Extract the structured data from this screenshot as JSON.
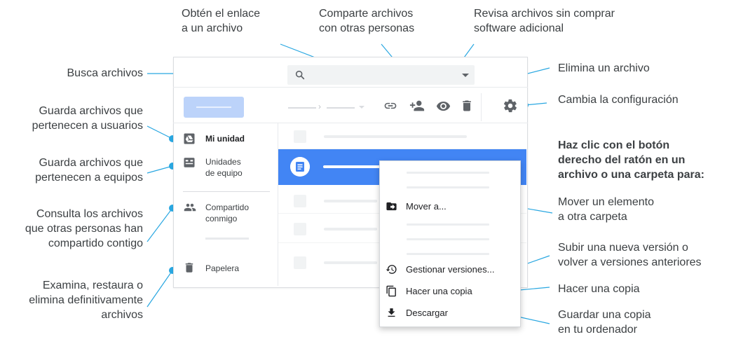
{
  "annotations": {
    "get_link": "Obtén el enlace\na un archivo",
    "share": "Comparte archivos\ncon otras personas",
    "preview": "Revisa archivos sin comprar\nsoftware adicional",
    "search": "Busca archivos",
    "delete": "Elimina un archivo",
    "settings": "Cambia la configuración",
    "my_drive": "Guarda archivos que\npertenecen a usuarios",
    "team_drives": "Guarda archivos que\npertenecen a equipos",
    "shared": "Consulta los archivos\nque otras personas han\ncompartido contigo",
    "trash": "Examina, restaura o\nelimina definitivamente\narchivos",
    "right_click_heading": "Haz clic con el botón\nderecho del ratón en un\narchivo o una carpeta para:",
    "move": "Mover un elemento\na otra carpeta",
    "versions": "Subir una nueva versión o\nvolver a versiones anteriores",
    "copy": "Hacer una copia",
    "download": "Guardar una copia\nen tu ordenador"
  },
  "sidebar": {
    "my_drive": "Mi unidad",
    "team_drives": "Unidades\nde equipo",
    "shared_with_me": "Compartido\nconmigo",
    "trash": "Papelera"
  },
  "context_menu": {
    "move": "Mover a...",
    "manage_versions": "Gestionar versiones...",
    "make_copy": "Hacer una copia",
    "download": "Descargar"
  },
  "colors": {
    "accent": "#4285f4",
    "callout": "#29a7e1",
    "icon": "#5f6368",
    "new_button": "#bcd3fa"
  },
  "icons": [
    "search-icon",
    "link-icon",
    "add-person-icon",
    "eye-icon",
    "trash-icon",
    "gear-icon",
    "drive-icon",
    "team-drive-icon",
    "people-icon",
    "doc-icon",
    "folder-move-icon",
    "history-icon",
    "copy-icon",
    "download-icon"
  ]
}
